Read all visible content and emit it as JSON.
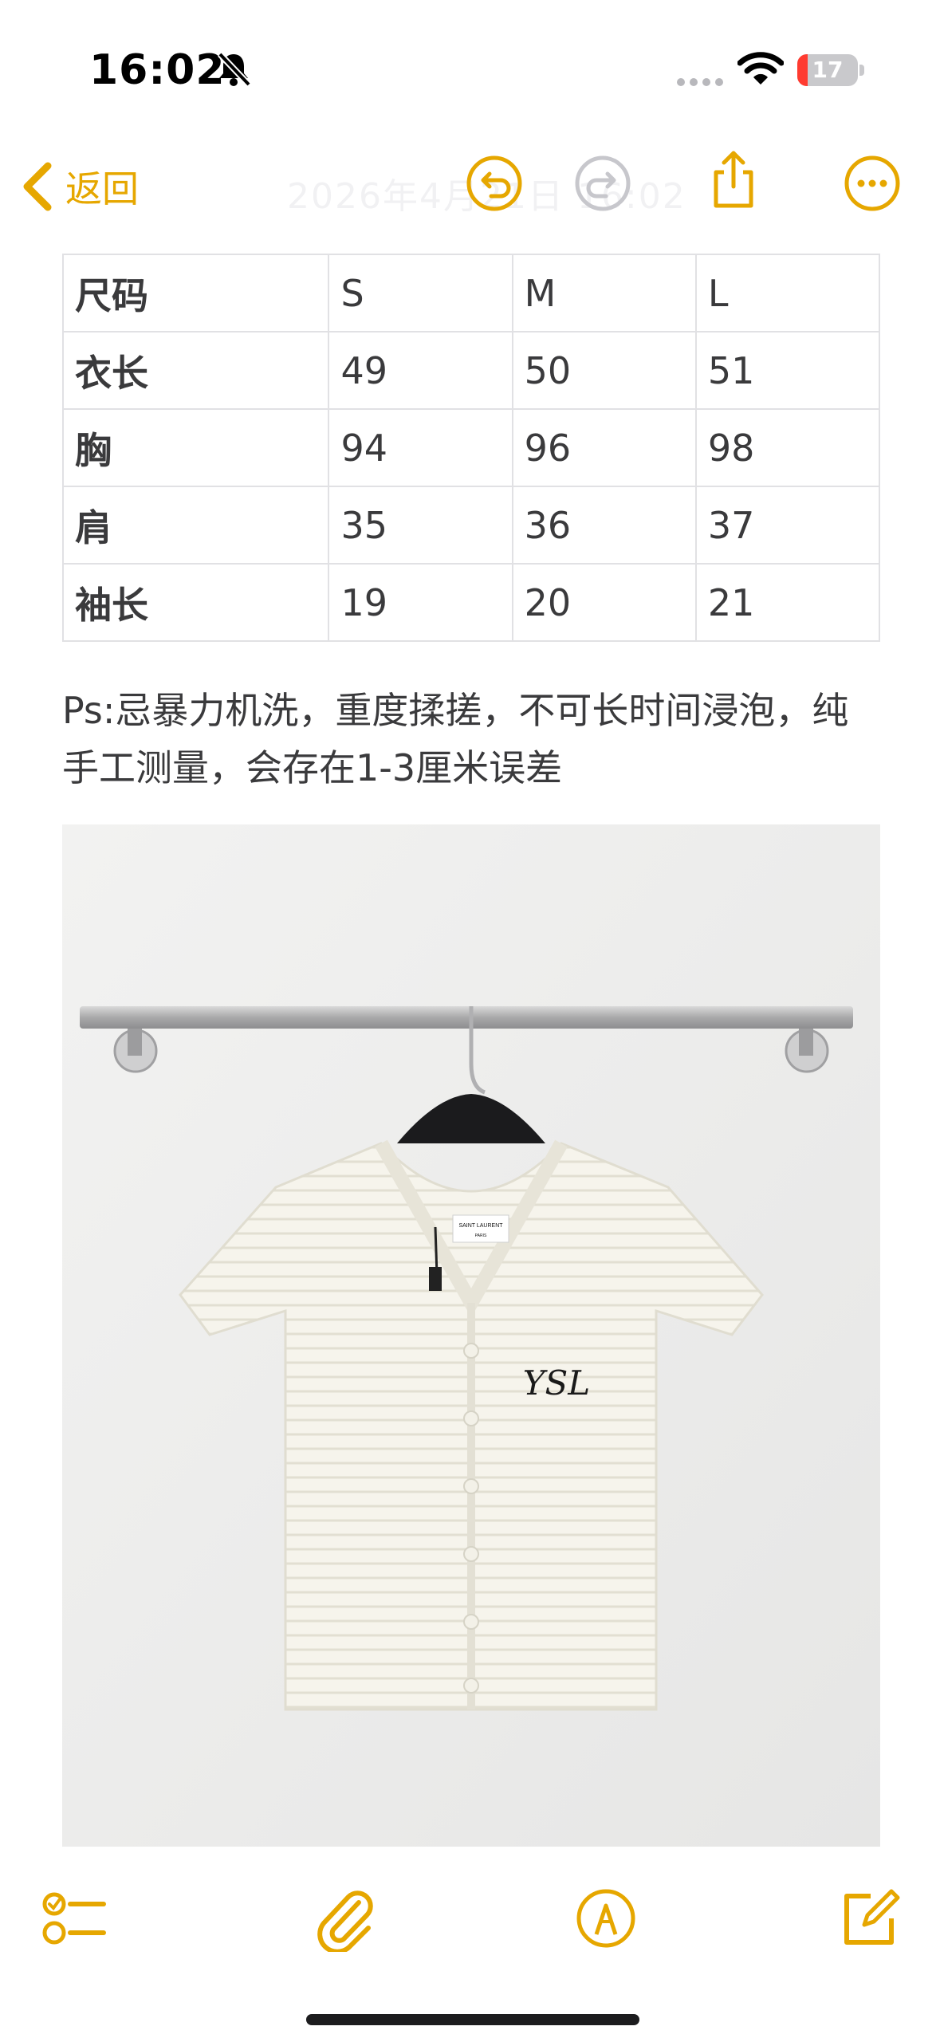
{
  "status_bar": {
    "time": "16:02",
    "battery": "17",
    "battery_level": 0.17,
    "silent_icon": "bell-slash-icon",
    "wifi_icon": "wifi-icon"
  },
  "nav": {
    "back_label": "返回",
    "faded_title": "2026年4月21日 16:02",
    "icons": [
      "undo-icon",
      "redo-icon",
      "share-icon",
      "more-icon"
    ]
  },
  "size_table": {
    "header": [
      "尺码",
      "S",
      "M",
      "L"
    ],
    "rows": [
      [
        "衣长",
        "49",
        "50",
        "51"
      ],
      [
        "胸",
        "94",
        "96",
        "98"
      ],
      [
        "肩",
        "35",
        "36",
        "37"
      ],
      [
        "袖长",
        "19",
        "20",
        "21"
      ]
    ]
  },
  "note": "Ps:忌暴力机洗，重度揉搓，不可长时间浸泡，纯手工测量，会存在1-3厘米误差",
  "photo": {
    "label_brand": "SAINT LAURENT",
    "label_city": "PARIS",
    "emblem": "YSL"
  },
  "toolbar": {
    "icons": [
      "checklist-icon",
      "paperclip-icon",
      "markup-pen-icon",
      "compose-icon"
    ]
  },
  "colors": {
    "accent": "#e6a700",
    "text": "#3a3a3c",
    "grid": "#e1e1e4",
    "battery_low": "#ff3b30"
  }
}
